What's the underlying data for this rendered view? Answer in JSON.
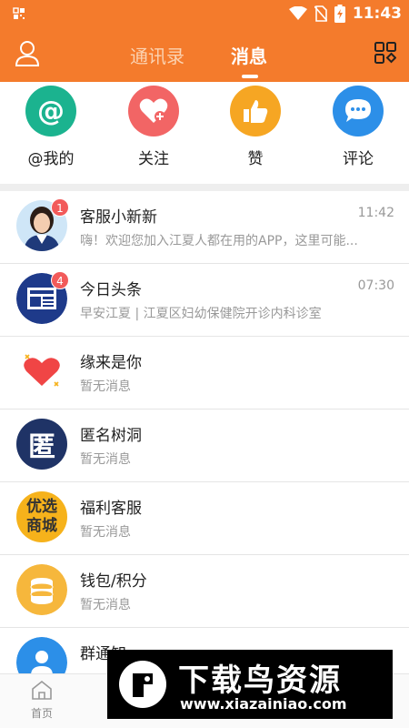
{
  "status_bar": {
    "time": "11:43"
  },
  "header": {
    "tabs": [
      {
        "label": "通讯录"
      },
      {
        "label": "消息"
      }
    ]
  },
  "quick_actions": [
    {
      "label": "@我的",
      "icon": "at-icon",
      "color": "#1bb38f"
    },
    {
      "label": "关注",
      "icon": "heart-plus-icon",
      "color": "#f26565"
    },
    {
      "label": "赞",
      "icon": "thumbs-up-icon",
      "color": "#f6a623"
    },
    {
      "label": "评论",
      "icon": "comment-icon",
      "color": "#2c8fe8"
    }
  ],
  "messages": [
    {
      "name": "客服小新新",
      "preview": "嗨！欢迎您加入江夏人都在用的APP，这里可能...",
      "time": "11:42",
      "badge": "1"
    },
    {
      "name": "今日头条",
      "preview": "早安江夏 | 江夏区妇幼保健院开诊内科诊室",
      "time": "07:30",
      "badge": "4"
    },
    {
      "name": "缘来是你",
      "preview": "暂无消息",
      "time": "",
      "badge": ""
    },
    {
      "name": "匿名树洞",
      "preview": "暂无消息",
      "time": "",
      "badge": "",
      "avatar_text": "匿"
    },
    {
      "name": "福利客服",
      "preview": "暂无消息",
      "time": "",
      "badge": "",
      "avatar_text": "优选商城"
    },
    {
      "name": "钱包/积分",
      "preview": "暂无消息",
      "time": "",
      "badge": ""
    },
    {
      "name": "群通知",
      "preview": "",
      "time": "",
      "badge": ""
    }
  ],
  "bottom_nav": {
    "home_label": "首页"
  },
  "watermark": {
    "title": "下载鸟资源",
    "url": "www.xiazainiao.com"
  }
}
